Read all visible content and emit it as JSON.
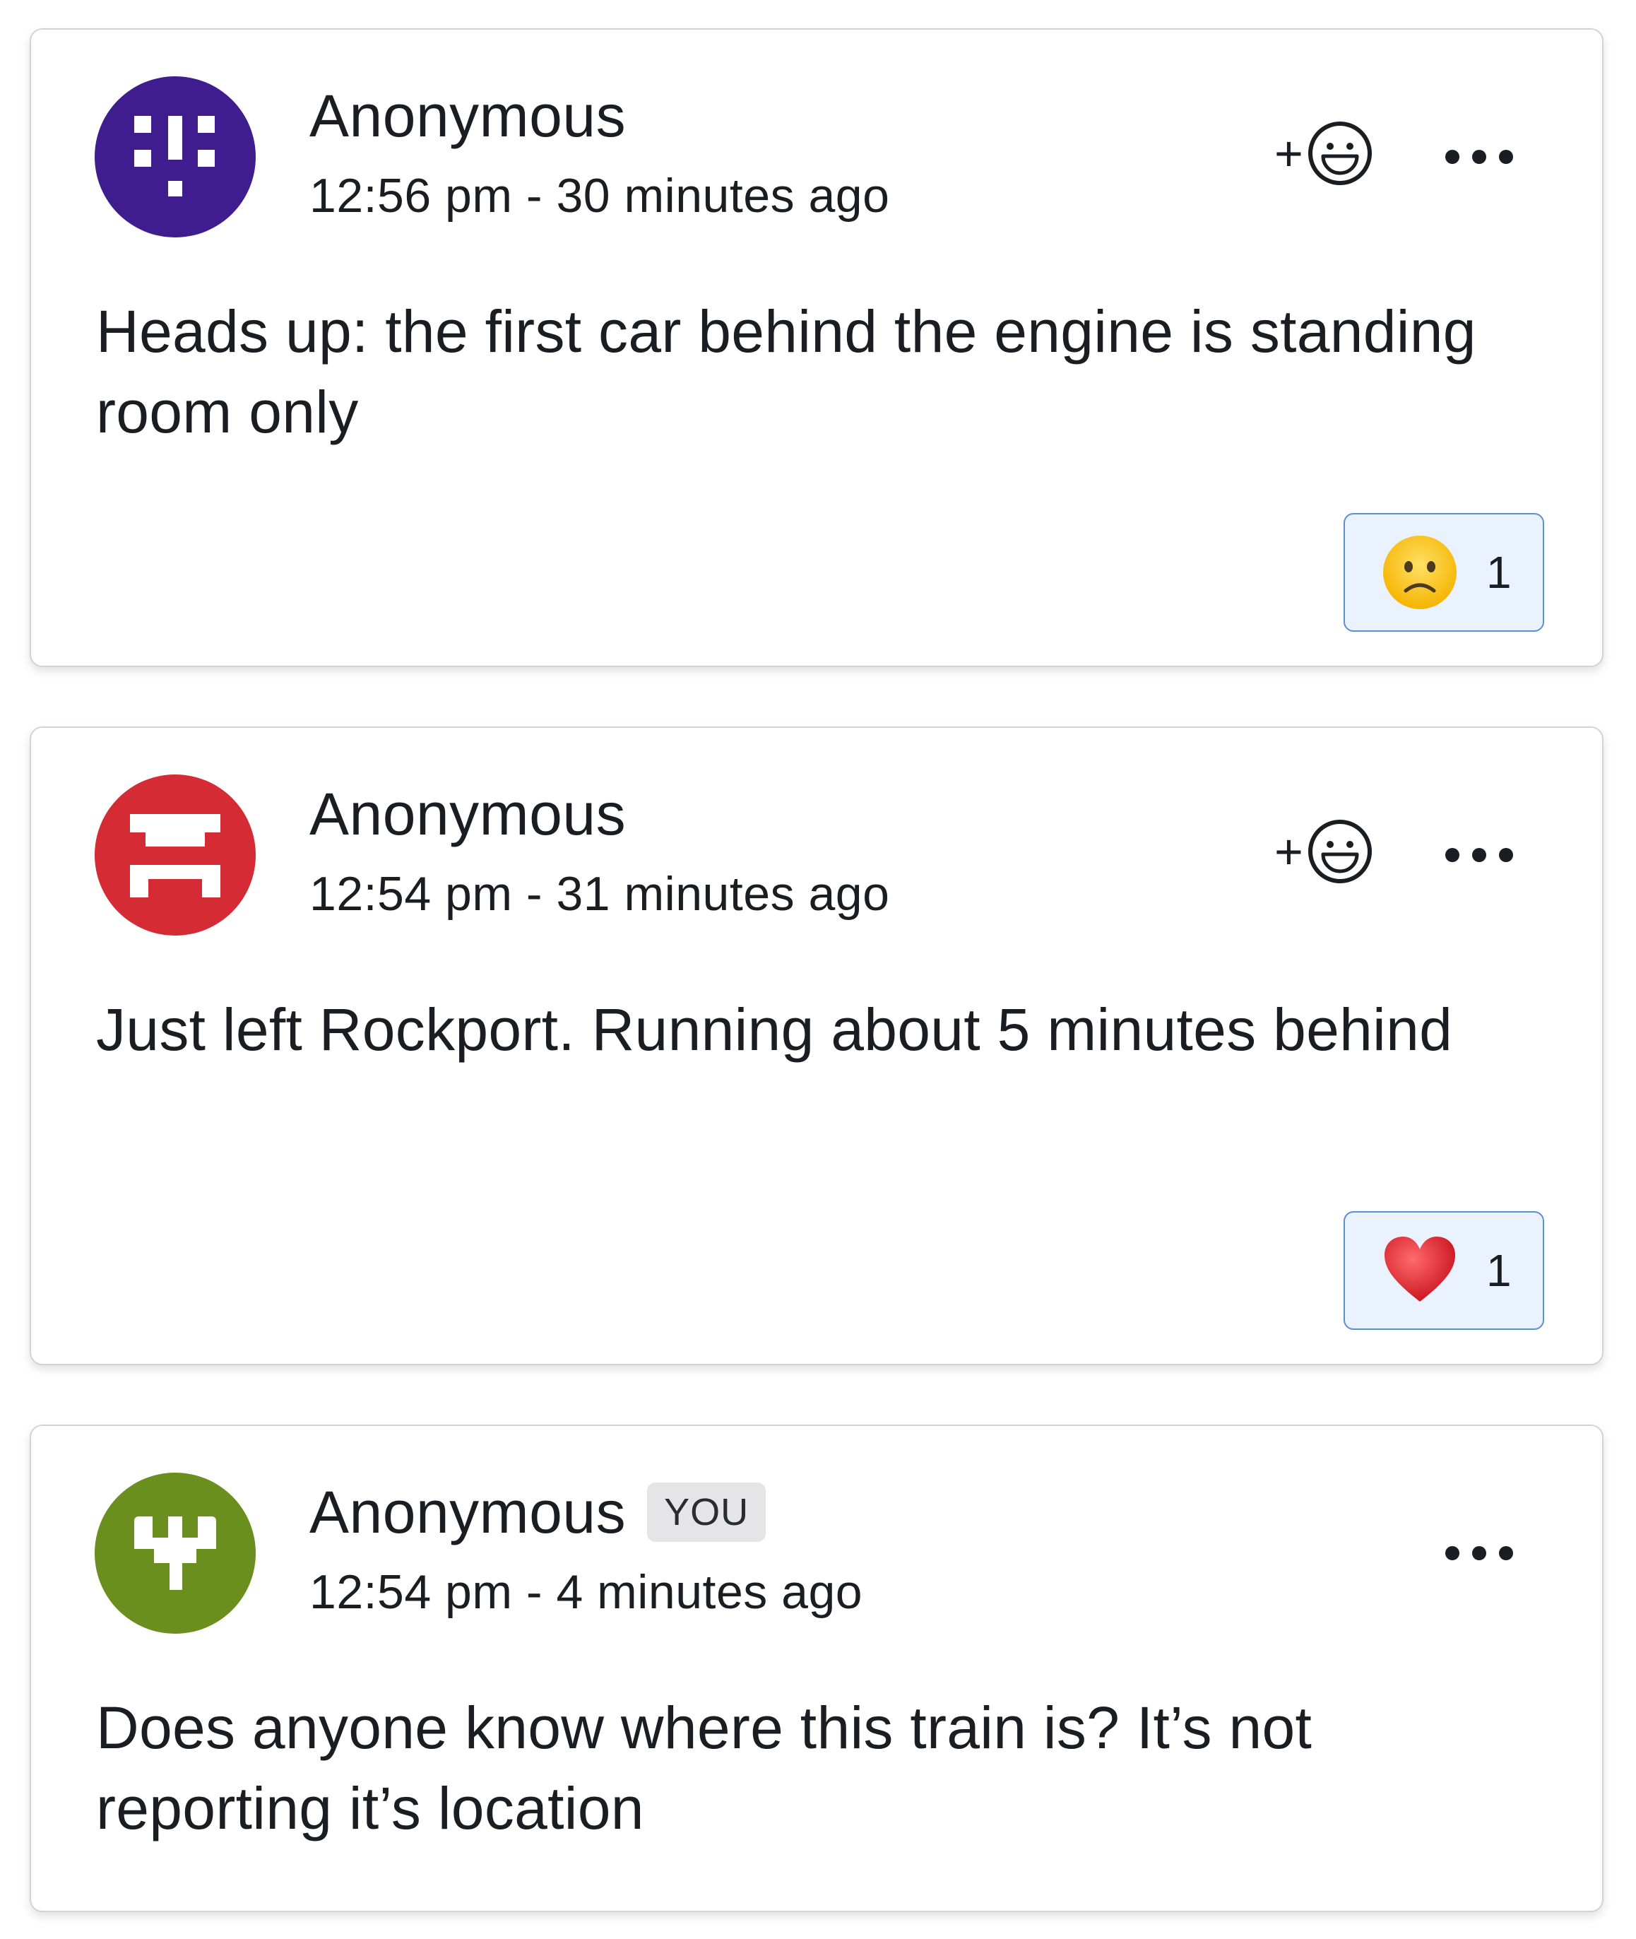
{
  "posts": [
    {
      "author": "Anonymous",
      "timestamp": "12:56 pm - 30 minutes ago",
      "message": "Heads up: the first car behind the engine is standing room only",
      "avatar_color": "#3f1d8f",
      "add_reaction_label": "+",
      "reaction": {
        "emoji": "slightly-frowning-face-icon",
        "count": "1"
      }
    },
    {
      "author": "Anonymous",
      "timestamp": "12:54 pm - 31 minutes ago",
      "message": "Just left Rockport. Running about 5 minutes behind",
      "avatar_color": "#d42b34",
      "add_reaction_label": "+",
      "reaction": {
        "emoji": "red-heart-icon",
        "count": "1"
      }
    },
    {
      "author": "Anonymous",
      "badge": "YOU",
      "timestamp": "12:54 pm - 4 minutes ago",
      "message": "Does anyone know where this train is? It’s not reporting it’s location",
      "avatar_color": "#6a8f1f"
    }
  ]
}
